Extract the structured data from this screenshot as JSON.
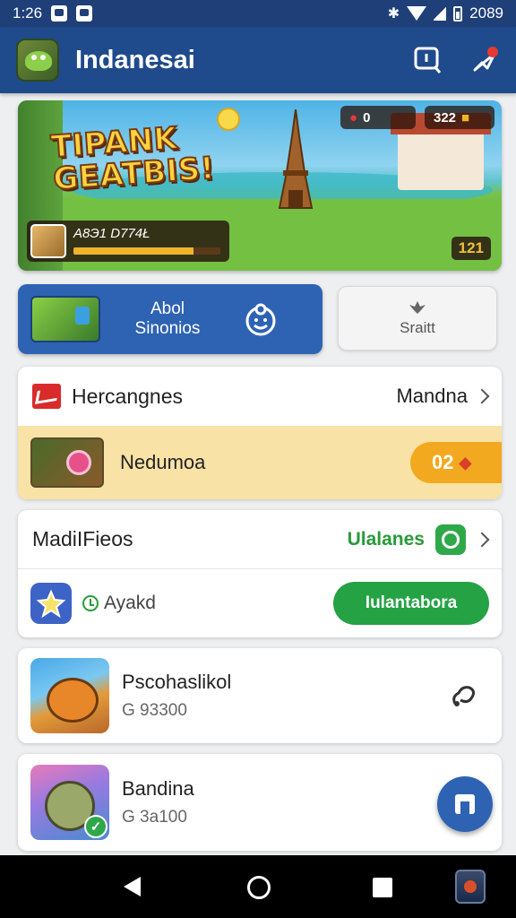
{
  "status_bar": {
    "time": "1:26",
    "right_text": "2089"
  },
  "app_bar": {
    "title": "Indanesai",
    "actions": [
      "search-icon",
      "rocket-icon"
    ]
  },
  "banner": {
    "headline_line1": "TIPANK",
    "headline_line2": "GEATBIS!",
    "stat_left": "0",
    "stat_right": "322",
    "player_text": "A8Э1 D774Ł",
    "progress": 0.82,
    "level": "121"
  },
  "primary_action": {
    "label_line1": "Abol",
    "label_line2": "Sinonios"
  },
  "secondary_action": {
    "label": "Sraitt"
  },
  "section1": {
    "title": "Hercangnes",
    "link_label": "Mandna",
    "featured": {
      "label": "Nedumoa",
      "badge": "02"
    }
  },
  "section2": {
    "title": "MadiIFieos",
    "status": "Ulalanes",
    "row_label": "Ayakd",
    "install_label": "Iulantabora"
  },
  "games": [
    {
      "name": "Pscohaslikol",
      "count": "G 93300"
    },
    {
      "name": "Bandina",
      "count": "G 3a100"
    }
  ],
  "colors": {
    "app_bar": "#1f4a8c",
    "primary": "#2e63b3",
    "green": "#25a244",
    "badge": "#f3a91f",
    "featured_bg": "#f9e2a6"
  }
}
